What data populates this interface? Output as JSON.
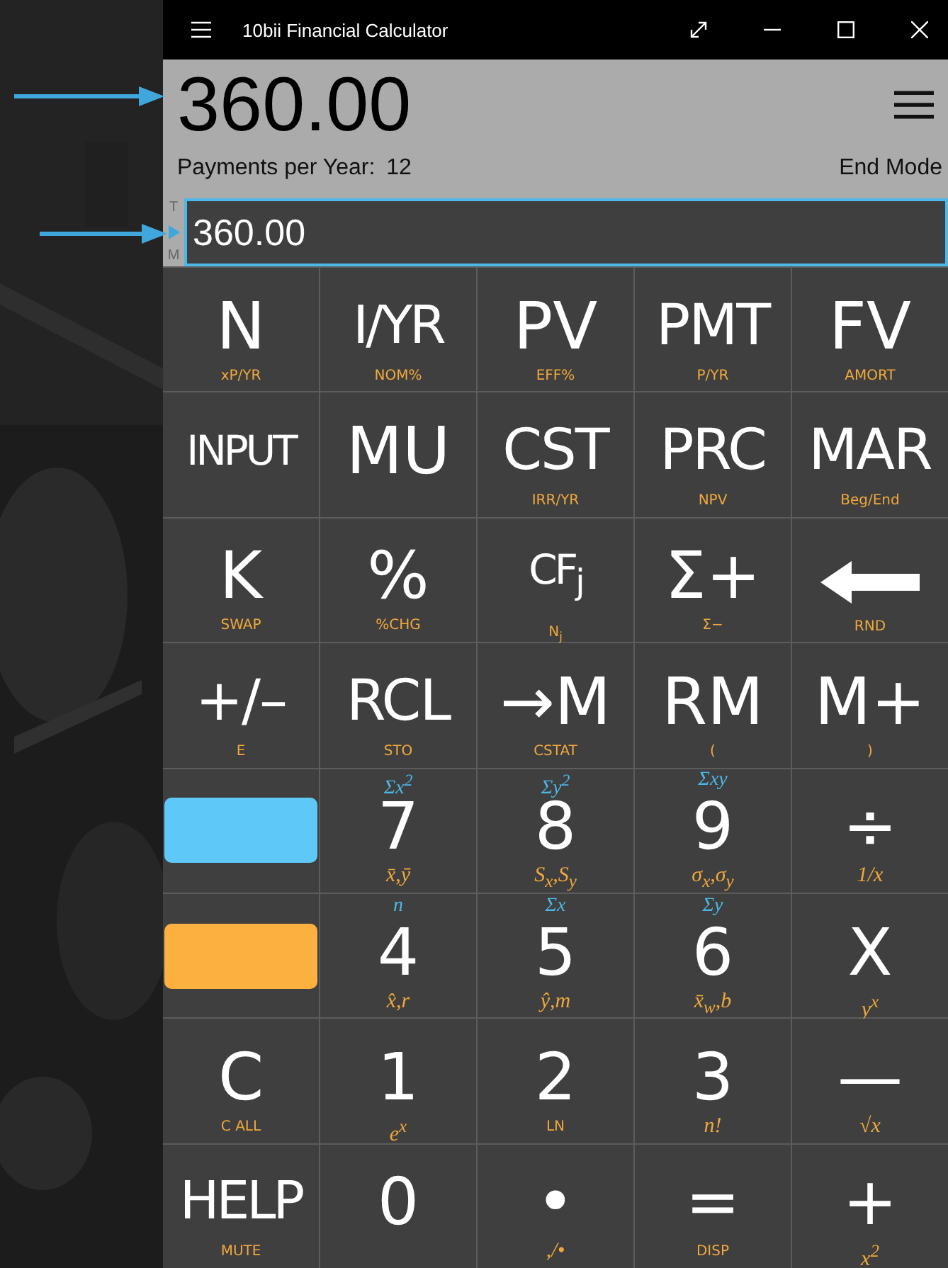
{
  "window": {
    "title": "10bii Financial Calculator"
  },
  "display": {
    "value": "360.00",
    "payments_label": "Payments per Year:",
    "payments_value": "12",
    "mode": "End Mode"
  },
  "stack": {
    "top_marker": "T",
    "bottom_marker": "M",
    "value": "360.00"
  },
  "keys": [
    {
      "kind": "key",
      "label": "N",
      "sub": "xP/YR"
    },
    {
      "kind": "key",
      "label": "I/YR",
      "sub": "NOM%"
    },
    {
      "kind": "key",
      "label": "PV",
      "sub": "EFF%"
    },
    {
      "kind": "key",
      "label": "PMT",
      "sub": "P/YR"
    },
    {
      "kind": "key",
      "label": "FV",
      "sub": "AMORT"
    },
    {
      "kind": "key",
      "label": "INPUT"
    },
    {
      "kind": "key",
      "label": "MU"
    },
    {
      "kind": "key",
      "label": "CST",
      "sub": "IRR/YR"
    },
    {
      "kind": "key",
      "label": "PRC",
      "sub": "NPV"
    },
    {
      "kind": "key",
      "label": "MAR",
      "sub": "Beg/End"
    },
    {
      "kind": "key",
      "label": "K",
      "sub": "SWAP"
    },
    {
      "kind": "key",
      "label": "%",
      "sub": "%CHG"
    },
    {
      "kind": "key",
      "label": "CF$_{j}$",
      "sub": "N$_{j}$"
    },
    {
      "kind": "key",
      "label": "Σ+",
      "sub": "Σ−"
    },
    {
      "kind": "arrow",
      "sub": "RND"
    },
    {
      "kind": "key",
      "label": "+/–",
      "sub": "E"
    },
    {
      "kind": "key",
      "label": "RCL",
      "sub": "STO"
    },
    {
      "kind": "key",
      "label": "→M",
      "sub": "CSTAT"
    },
    {
      "kind": "key",
      "label": "RM",
      "sub": "("
    },
    {
      "kind": "key",
      "label": "M+",
      "sub": ")"
    },
    {
      "kind": "shift",
      "color": "#5ec8f8"
    },
    {
      "kind": "key",
      "label": "7",
      "top": "Σx$^{2}$",
      "sub": "x̄,ȳ",
      "math": true
    },
    {
      "kind": "key",
      "label": "8",
      "top": "Σy$^{2}$",
      "sub": "S$_{x}$,S$_{y}$",
      "math": true
    },
    {
      "kind": "key",
      "label": "9",
      "top": "Σxy",
      "sub": "σ$_{x}$,σ$_{y}$",
      "math": true
    },
    {
      "kind": "key",
      "label": "÷",
      "sub": "1/x",
      "math": true
    },
    {
      "kind": "shift",
      "color": "#fcb040"
    },
    {
      "kind": "key",
      "label": "4",
      "top": "n",
      "sub": "x̂,r",
      "math": true
    },
    {
      "kind": "key",
      "label": "5",
      "top": "Σx",
      "sub": "ŷ,m",
      "math": true
    },
    {
      "kind": "key",
      "label": "6",
      "top": "Σy",
      "sub": "x̄$_{w}$,b",
      "math": true
    },
    {
      "kind": "key",
      "label": "X",
      "sub": "y$^{x}$",
      "math": true
    },
    {
      "kind": "key",
      "label": "C",
      "sub": "C ALL"
    },
    {
      "kind": "key",
      "label": "1",
      "sub": "e$^{x}$",
      "math": true
    },
    {
      "kind": "key",
      "label": "2",
      "sub": "LN"
    },
    {
      "kind": "key",
      "label": "3",
      "sub": "n!",
      "math": true
    },
    {
      "kind": "key",
      "label": "—",
      "sub": "√x",
      "math": true
    },
    {
      "kind": "key",
      "label": "HELP",
      "sub": "MUTE"
    },
    {
      "kind": "key",
      "label": "0"
    },
    {
      "kind": "key",
      "label": "•",
      "sub": ",/•",
      "math": true
    },
    {
      "kind": "key",
      "label": "=",
      "sub": "DISP"
    },
    {
      "kind": "key",
      "label": "+",
      "sub": "x$^{2}$",
      "math": true
    }
  ]
}
